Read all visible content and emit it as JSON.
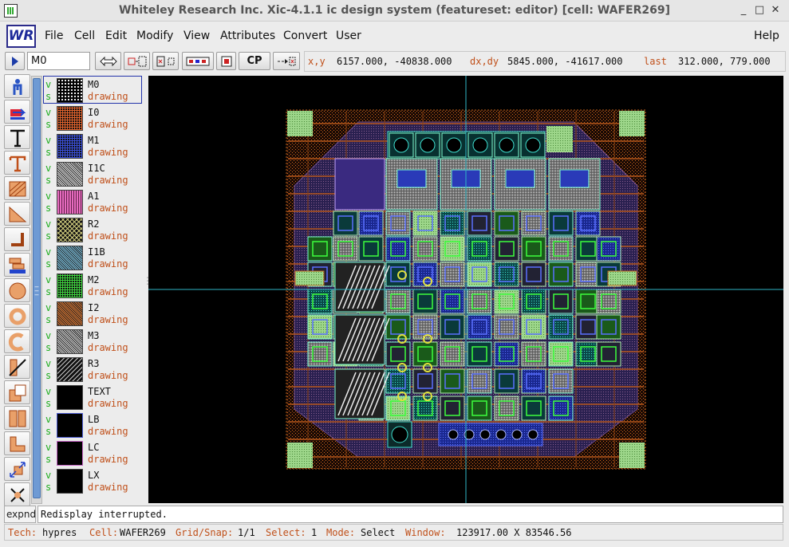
{
  "window": {
    "title": "Whiteley Research Inc.  Xic-4.1.1 ic design system (featureset: editor)  [cell: WAFER269]",
    "buttons": {
      "minimize": "_",
      "maximize": "□",
      "close": "✕"
    }
  },
  "menubar": {
    "logo": "WR",
    "items": [
      "File",
      "Cell",
      "Edit",
      "Modify",
      "View",
      "Attributes",
      "Convert",
      "User"
    ],
    "help": "Help"
  },
  "toolbar": {
    "current_layer": "M0",
    "cp_label": "CP",
    "coords": {
      "xy_label": "x,y",
      "xy_value": "6157.000, -40838.000",
      "dxdy_label": "dx,dy",
      "dxdy_value": "5845.000, -41617.000",
      "last_label": "last",
      "last_value": "312.000, 779.000"
    }
  },
  "tools": [
    "run-icon",
    "wire-icon",
    "text-icon",
    "label-icon",
    "box-icon",
    "polygon-icon",
    "path-icon",
    "stack-icon",
    "round-icon",
    "donut-icon",
    "arc-icon",
    "break-icon",
    "erase-icon",
    "xor-icon",
    "spin-icon",
    "mirror-icon"
  ],
  "layers": [
    {
      "name": "M0",
      "purpose": "drawing",
      "vis": "v",
      "sel": "s",
      "color": "#ffffff",
      "pattern": "dots"
    },
    {
      "name": "I0",
      "purpose": "drawing",
      "vis": "v",
      "sel": "s",
      "color": "#e0622c",
      "pattern": "grid"
    },
    {
      "name": "M1",
      "purpose": "drawing",
      "vis": "v",
      "sel": "s",
      "color": "#3a4fd8",
      "pattern": "grid"
    },
    {
      "name": "I1C",
      "purpose": "drawing",
      "vis": "v",
      "sel": "s",
      "color": "#e6e6e6",
      "pattern": "fine"
    },
    {
      "name": "A1",
      "purpose": "drawing",
      "vis": "v",
      "sel": "s",
      "color": "#e86cc0",
      "pattern": "vlines"
    },
    {
      "name": "R2",
      "purpose": "drawing",
      "vis": "v",
      "sel": "s",
      "color": "#d4d080",
      "pattern": "cross"
    },
    {
      "name": "I1B",
      "purpose": "drawing",
      "vis": "v",
      "sel": "s",
      "color": "#7ec7e6",
      "pattern": "fine"
    },
    {
      "name": "M2",
      "purpose": "drawing",
      "vis": "v",
      "sel": "s",
      "color": "#3ed23e",
      "pattern": "grid"
    },
    {
      "name": "I2",
      "purpose": "drawing",
      "vis": "v",
      "sel": "s",
      "color": "#e07830",
      "pattern": "fine"
    },
    {
      "name": "M3",
      "purpose": "drawing",
      "vis": "v",
      "sel": "s",
      "color": "#d8d8d8",
      "pattern": "fine"
    },
    {
      "name": "R3",
      "purpose": "drawing",
      "vis": "v",
      "sel": "s",
      "color": "#c8c8c8",
      "pattern": "diag"
    },
    {
      "name": "TEXT",
      "purpose": "drawing",
      "vis": "v",
      "sel": "s",
      "color": "#000000",
      "pattern": "none"
    },
    {
      "name": "LB",
      "purpose": "drawing",
      "vis": "v",
      "sel": "s",
      "color": "#000000",
      "pattern": "none"
    },
    {
      "name": "LC",
      "purpose": "drawing",
      "vis": "v",
      "sel": "s",
      "color": "#000000",
      "pattern": "none"
    },
    {
      "name": "LX",
      "purpose": "drawing",
      "vis": "v",
      "sel": "s",
      "color": "#000000",
      "pattern": "none"
    }
  ],
  "message": {
    "expand_label": "expnd",
    "text": "Redisplay interrupted."
  },
  "status": {
    "tech_label": "Tech:",
    "tech": "hypres",
    "cell_label": "Cell:",
    "cell": "WAFER269",
    "grid_label": "Grid/Snap:",
    "grid": "1/1",
    "select_label": "Select:",
    "select": "1",
    "mode_label": "Mode:",
    "mode": "Select",
    "window_label": "Window:",
    "window": "123917.00 X 83546.56"
  },
  "colors": {
    "accent_orange": "#c0501a",
    "visible_green": "#1cad1c",
    "canvas_bg": "#000000",
    "crosshair": "#2fb6c6"
  }
}
